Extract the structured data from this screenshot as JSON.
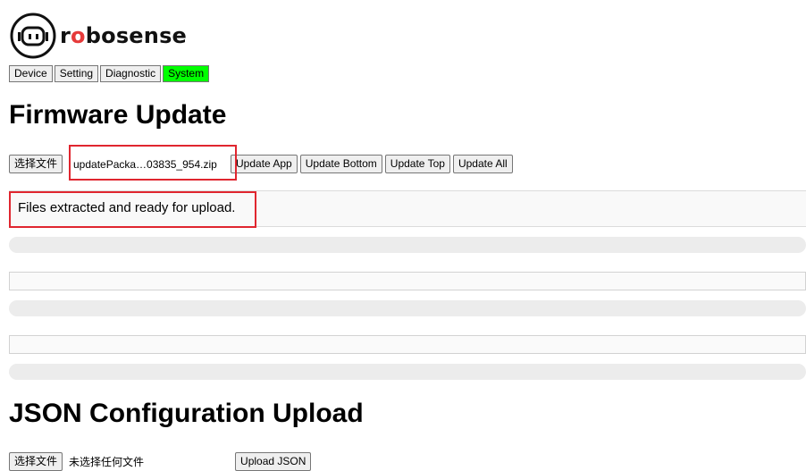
{
  "brand": {
    "name_prefix": "r",
    "name_o": "o",
    "name_suffix": "bosense"
  },
  "nav": {
    "tabs": [
      {
        "label": "Device",
        "active": false
      },
      {
        "label": "Setting",
        "active": false
      },
      {
        "label": "Diagnostic",
        "active": false
      },
      {
        "label": "System",
        "active": true
      }
    ]
  },
  "firmware": {
    "title": "Firmware Update",
    "choose_file_label": "选择文件",
    "file_name": "updatePacka…03835_954.zip",
    "buttons": {
      "update_app": "Update App",
      "update_bottom": "Update Bottom",
      "update_top": "Update Top",
      "update_all": "Update All"
    },
    "status_message": "Files extracted and ready for upload."
  },
  "json_config": {
    "title": "JSON Configuration Upload",
    "choose_file_label": "选择文件",
    "no_file_text": "未选择任何文件",
    "upload_label": "Upload JSON"
  },
  "colors": {
    "active_tab": "#00ff00",
    "highlight_box": "#e0262f"
  }
}
